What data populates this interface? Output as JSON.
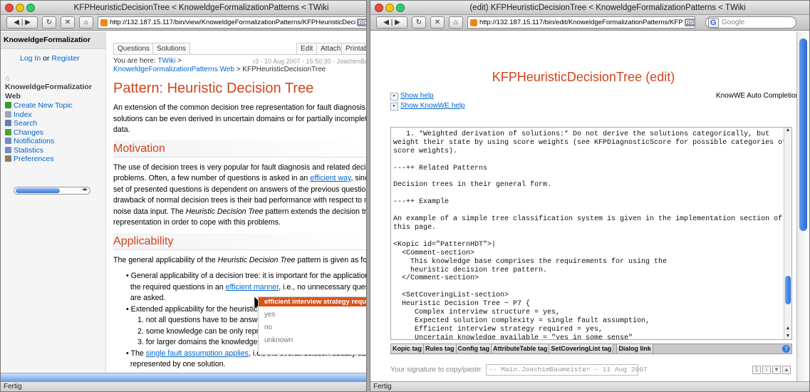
{
  "left_window": {
    "title": "KFPHeuristicDecisionTree < KnoweldgeFormalizationPatterns < TWiki",
    "url": "http://132.187.15.117/bin/view/KnoweldgeFormalizationPatterns/KFPHeuristicDeci",
    "rss": "RSS",
    "status": "Fertig",
    "sidebar": {
      "header": "KnoweldgeFormalizatior",
      "login": "Log In",
      "login_or": "or",
      "register": "Register",
      "web_title": "KnoweldgeFormalizatior Web",
      "items": [
        {
          "label": "Create New Topic",
          "color": "#3a9a2a"
        },
        {
          "label": "Index",
          "color": "#9aa4c0"
        },
        {
          "label": "Search",
          "color": "#6b7da8"
        },
        {
          "label": "Changes",
          "color": "#49a038"
        },
        {
          "label": "Notifications",
          "color": "#6e8fbf"
        },
        {
          "label": "Statistics",
          "color": "#7a8cc2"
        },
        {
          "label": "Preferences",
          "color": "#8c7a6a"
        }
      ]
    },
    "tabs": {
      "questions": "Questions",
      "solutions": "Solutions",
      "edit": "Edit",
      "attach": "Attach",
      "printable": "Printable"
    },
    "breadcrumb": {
      "prefix": "You are here:",
      "twiki": "TWiki",
      "sep": ">",
      "revision": "r3 - 10 Aug 2007 - 15:50:30 - JoachimBaumeister",
      "web_link": "KnoweldgeFormalizationPatterns Web",
      "current": "> KFPHeuristicDecisionTree"
    },
    "page_title": "Pattern: Heuristic Decision Tree",
    "intro": [
      "An extension of the common decision tree representation for fault diagnosis. Here,",
      "solutions can be even derived in uncertain domains or for partially incomplete input",
      "data."
    ],
    "motivation_heading": "Motivation",
    "motivation": {
      "l1": "The use of decision trees is very popular for fault diagnosis and related decision",
      "l2a": "problems. Often, a few number of questions is asked in an",
      "l2link": "efficient way",
      "l2b": ", since the",
      "l3": "set of presented questions is dependent on answers of the previous questions. A",
      "l4": "drawback of normal decision trees is their bad performance with respect to missing",
      "l5a": "noise data input. The",
      "l5em": "Heuristic Decision Tree",
      "l5b": "pattern extends the decision tree",
      "l6": "representation in order to cope with this problems."
    },
    "applicability_heading": "Applicability",
    "applicability": {
      "intro_a": "The general applicability of the",
      "intro_em": "Heuristic Decision Tree",
      "intro_b": "pattern is given as follows:",
      "b1_l1": "General applicability of a decision tree: it is important for the application to a",
      "b1_l2a": "the required questions in an",
      "b1_l2link": "efficient manner",
      "b1_l2b": ", i.e., no unnecessary questions",
      "b1_l3": "are asked.",
      "b2": "Extended applicability for the heuristic v",
      "n1": "1.  not all questions have to be answ",
      "n2": "2.  some knowledge can be only repr",
      "n3": "3.  for larger domains the knowledge is dividable into modular partitions.",
      "b3a": "The",
      "b3link": "single fault assumption applies",
      "b3b": ", i.e., the overall solution usually can be",
      "b3_l2": "represented by one solution."
    },
    "popup": {
      "header": "efficient interview strategy required",
      "options": [
        "yes",
        "no",
        "unknown"
      ]
    }
  },
  "right_window": {
    "title": "(edit) KFPHeuristicDecisionTree < KnoweldgeFormalizationPatterns < TWiki",
    "url": "http://132.187.15.117/bin/edit/KnoweldgeFormalizationPatterns/KFP",
    "rss": "RSS",
    "search_placeholder": "Google",
    "status": "Fertig",
    "edit_title": "KFPHeuristicDecisionTree (edit)",
    "show_help": "Show help",
    "show_knowwe_help": "Show KnowWE help",
    "auto_completion": "KnowWE Auto Completion:",
    "editor_text": "   1. *Weighted derivation of solutions:* Do not derive the solutions categorically, but\nweight their state by using score weights (see KFPDiagnosticScore for possible categories of\nscore weights).\n\n---++ Related Patterns\n\nDecision trees in their general form.\n\n---++ Example\n\nAn example of a simple tree classification system is given in the implementation section of\nthis page.\n\n<Kopic id=\"PatternHDT\">|\n  <Comment-section>\n    This knowledge base comprises the requirements for using the\n    heuristic decision tree pattern.\n  </Comment-section>\n\n  <SetCoveringList-section>\n  Heuristic Decision Tree ~ P7 {\n     Complex interview structure = yes,\n     Expected solution complexity = single fault assumption,\n     Efficient interview strategy required = yes,\n     Uncertain knowledge available = \"yes in some sense\"\n  }\n  </SetCoveringList-section>",
    "buttons": [
      "Kopic tag",
      "Rules tag",
      "Config tag",
      "AttributeTable tag",
      "SetCoveringList tag",
      "Dialog link"
    ],
    "signature_label": "Your signature to copy/paste:",
    "signature_value": "-- Main.JoachimBaumeister - 11 Aug 2007"
  }
}
